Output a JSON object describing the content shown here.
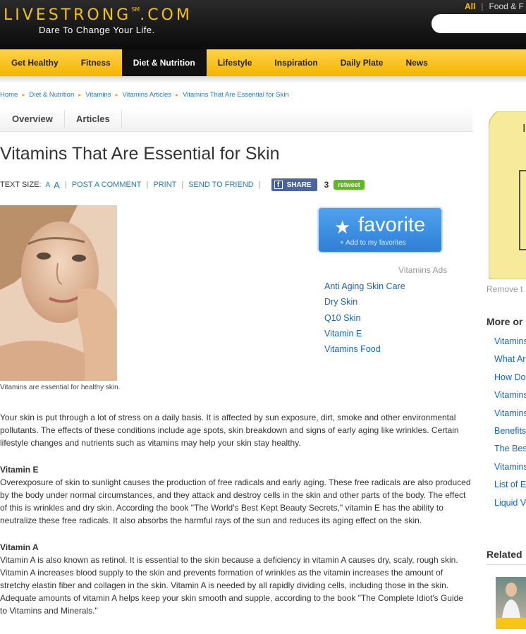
{
  "header": {
    "logo": "LIVESTRONG",
    "logo_sm": "SM",
    "logo_tld": ".COM",
    "tagline": "Dare To Change Your Life.",
    "top_link_all": "All",
    "top_link_food": "Food & F"
  },
  "nav": {
    "items": [
      "Get Healthy",
      "Fitness",
      "Diet & Nutrition",
      "Lifestyle",
      "Inspiration",
      "Daily Plate",
      "News"
    ],
    "active": "Diet & Nutrition"
  },
  "breadcrumb": [
    "Home",
    "Diet & Nutrition",
    "Vitamins",
    "Vitamins Articles",
    "Vitamins That Are Essential for Skin"
  ],
  "subtabs": [
    "Overview",
    "Articles"
  ],
  "article": {
    "title": "Vitamins That Are Essential for Skin",
    "tools": {
      "text_size_label": "TEXT SIZE:",
      "size_small": "A",
      "size_large": "A",
      "post_comment": "POST A COMMENT",
      "print": "PRINT",
      "send_to_friend": "SEND TO FRIEND",
      "share": "SHARE",
      "retweet_count": "3",
      "retweet": "retweet"
    },
    "caption": "Vitamins are essential for healthy skin.",
    "intro": "Your skin is put through a lot of stress on a daily basis. It is affected by sun exposure, dirt, smoke and other environmental pollutants. The effects of these conditions include age spots, skin breakdown and signs of early aging like wrinkles. Certain lifestyle changes and nutrients such as vitamins may help your skin stay healthy.",
    "sections": [
      {
        "heading": "Vitamin E",
        "text": "Overexposure of skin to sunlight causes the production of free radicals and early aging. These free radicals are also produced by the body under normal circumstances, and they attack and destroy cells in the skin and other parts of the body. The effect of this is wrinkles and dry skin. According the book \"The World's Best Kept Beauty Secrets,\" vitamin E has the ability to neutralize these free radicals. It also absorbs the harmful rays of the sun and reduces its aging effect on the skin."
      },
      {
        "heading": "Vitamin A",
        "text": "Vitamin A is also known as retinol. It is essential to the skin because a deficiency in vitamin A causes dry, scaly, rough skin. Vitamin A increases blood supply to the skin and prevents formation of wrinkles as the vitamin increases the amount of stretchy elastin fiber and collagen in the skin. Vitamin A is needed by all rapidly dividing cells, including those in the skin. Adequate amounts of vitamin A helps keep your skin smooth and supple, according to the book \"The Complete Idiot's Guide to Vitamins and Minerals.\""
      }
    ]
  },
  "favorite": {
    "label": "favorite",
    "sub": "+ Add to my favorites"
  },
  "ads": {
    "label": "Vitamins Ads",
    "links": [
      "Anti Aging Skin Care",
      "Dry Skin",
      "Q10 Skin",
      "Vitamin E",
      "Vitamins Food"
    ]
  },
  "sidebar": {
    "note_letter": "I",
    "remove": "Remove t",
    "more_title": "More or",
    "more_links": [
      "Vitamins",
      "What Ar",
      "How Do",
      "Vitamins",
      "Vitamins",
      "Benefits",
      "The Bes",
      "Vitamins",
      "List of E",
      "Liquid V"
    ],
    "related_title": "Related"
  },
  "colors": {
    "brand_yellow": "#f4c20d",
    "nav_active": "#111111",
    "link_blue": "#1565b8"
  }
}
